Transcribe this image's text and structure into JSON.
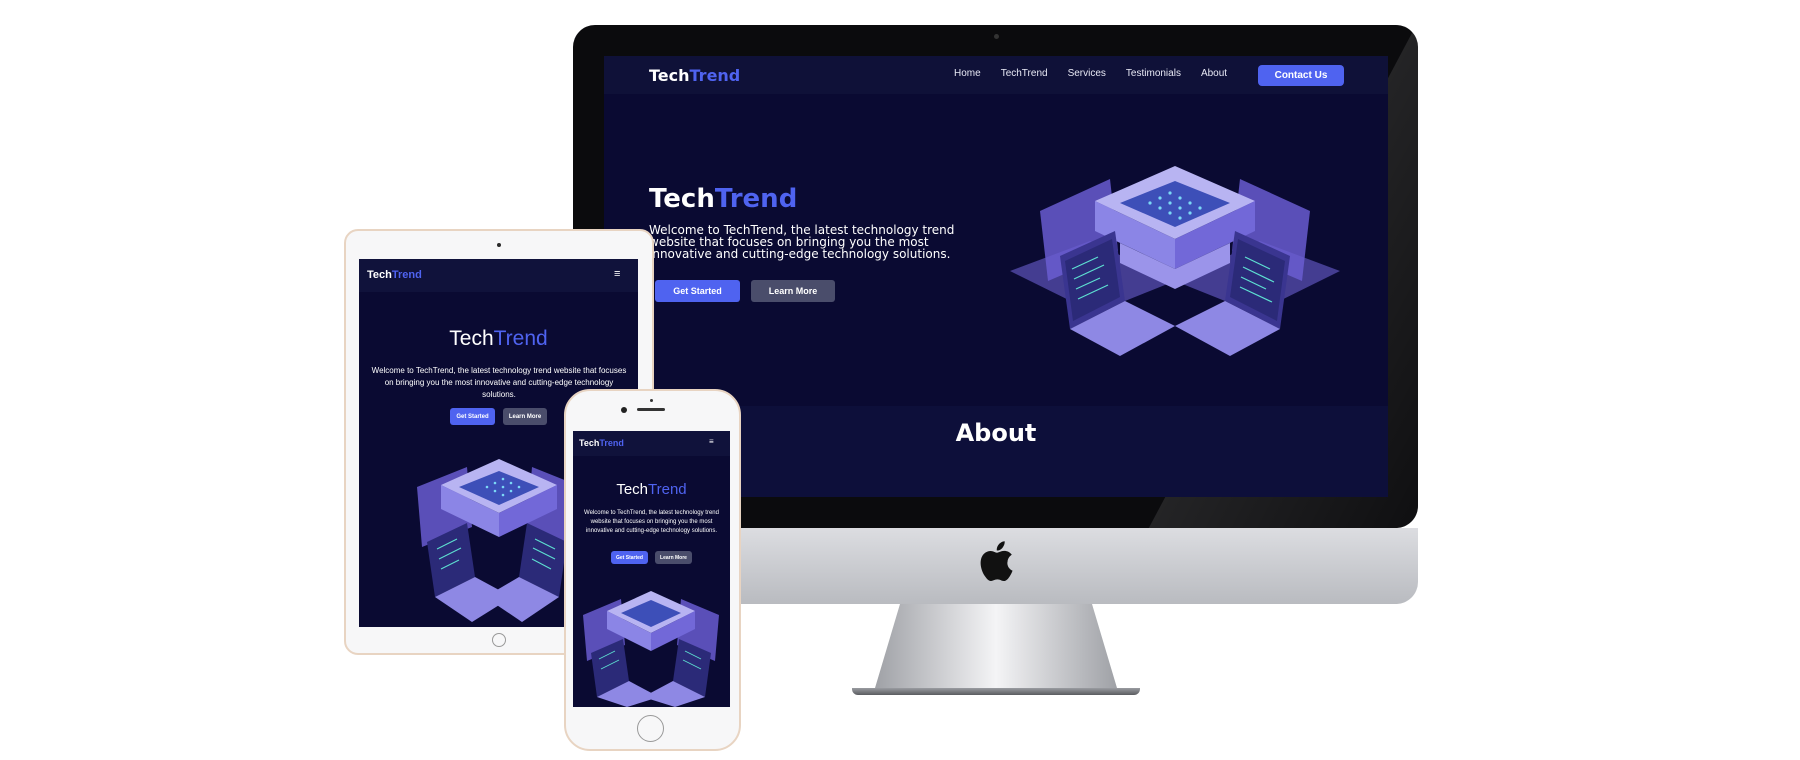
{
  "site": {
    "brand_main": "Tech",
    "brand_accent": "Trend",
    "nav_links": [
      "Home",
      "TechTrend",
      "Services",
      "Testimonials",
      "About"
    ],
    "contact_label": "Contact Us",
    "hero_title_main": "Tech",
    "hero_title_accent": "Trend",
    "hero_description": "Welcome to TechTrend, the latest technology trend website that focuses on bringing you the most innovative and cutting-edge technology solutions.",
    "get_started_label": "Get Started",
    "learn_more_label": "Learn More",
    "about_title": "About",
    "menu_icon": "≡"
  },
  "colors": {
    "background": "#0a0a32",
    "navbar": "#0f1138",
    "accent": "#4f63f0",
    "secondary_button": "#4a4d6b"
  },
  "icons": [
    "apple-logo-icon",
    "hamburger-menu-icon",
    "camera-icon",
    "home-button-icon"
  ]
}
